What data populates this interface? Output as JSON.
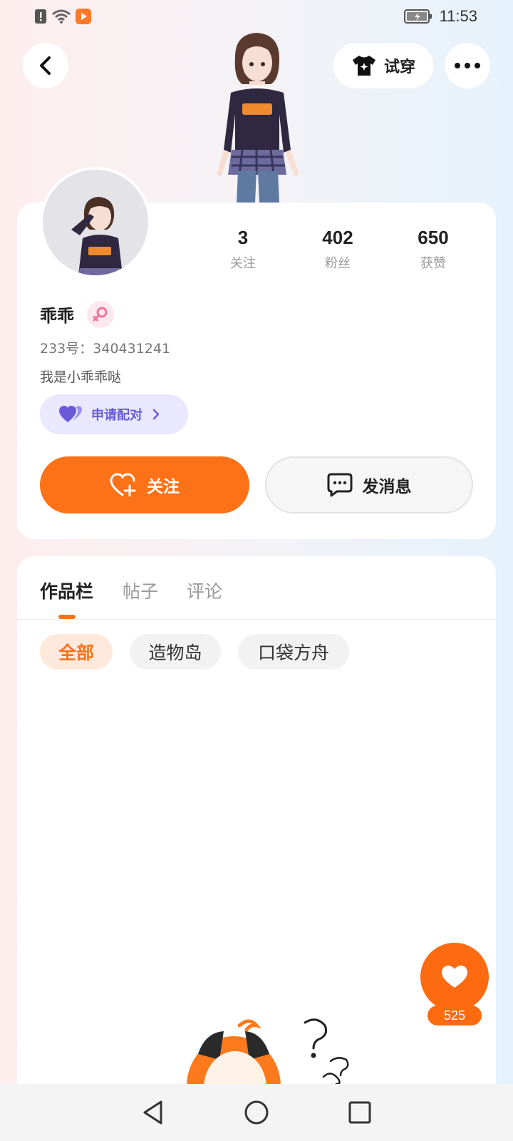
{
  "status_bar": {
    "time": "11:53"
  },
  "header": {
    "tryon_label": "试穿"
  },
  "profile": {
    "username": "乖乖",
    "uid": "233号：340431241",
    "bio": "我是小乖乖哒",
    "pair_label": "申请配对",
    "stats": [
      {
        "value": "3",
        "label": "关注"
      },
      {
        "value": "402",
        "label": "粉丝"
      },
      {
        "value": "650",
        "label": "获赞"
      }
    ],
    "follow_label": "关注",
    "message_label": "发消息"
  },
  "tabs": [
    {
      "label": "作品栏",
      "active": true
    },
    {
      "label": "帖子",
      "active": false
    },
    {
      "label": "评论",
      "active": false
    }
  ],
  "filters": [
    {
      "label": "全部",
      "active": true
    },
    {
      "label": "造物岛",
      "active": false
    },
    {
      "label": "口袋方舟",
      "active": false
    }
  ],
  "like_count": "525",
  "colors": {
    "accent": "#fd7117",
    "pair": "#6b5ad8"
  }
}
